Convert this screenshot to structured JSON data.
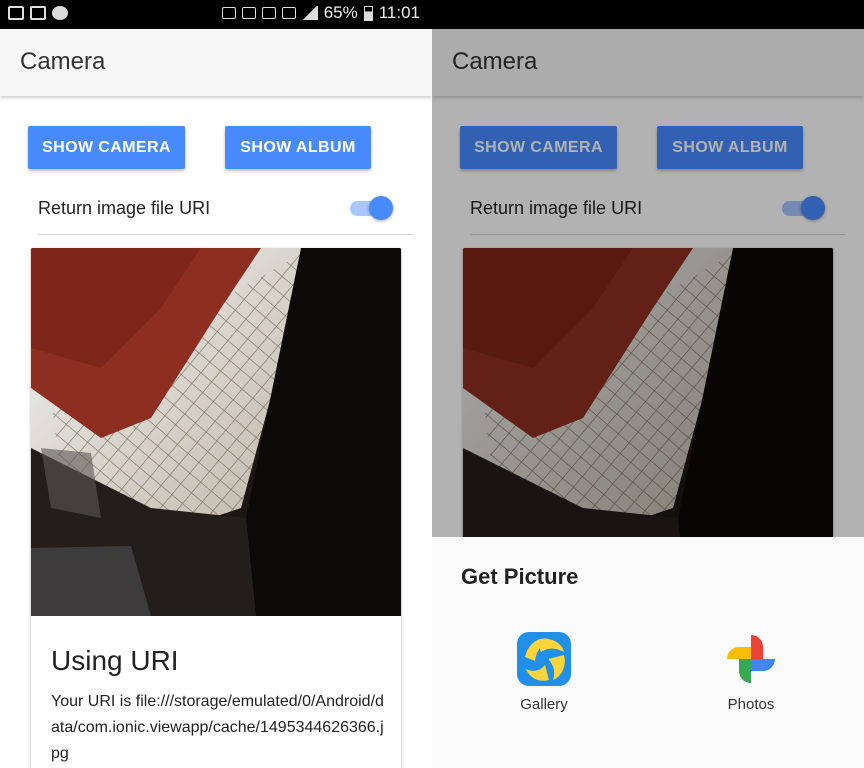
{
  "status_bar": {
    "battery": "65%",
    "time": "11:01"
  },
  "toolbar": {
    "title": "Camera"
  },
  "buttons": {
    "show_camera": "SHOW CAMERA",
    "show_album": "SHOW ALBUM"
  },
  "toggle": {
    "label": "Return image file URI",
    "checked": true
  },
  "card": {
    "title": "Using URI",
    "text": "Your URI is file:///storage/emulated/0/Android/data/com.ionic.viewapp/cache/1495344626366.jpg"
  },
  "sheet": {
    "title": "Get Picture",
    "apps": [
      {
        "label": "Gallery",
        "icon": "gallery-icon"
      },
      {
        "label": "Photos",
        "icon": "photos-icon"
      }
    ]
  },
  "colors": {
    "accent": "#488aff",
    "toggle_track": "#a8c6ff",
    "toolbar_bg": "#f7f7f7",
    "statusbar_bg": "#000000"
  }
}
